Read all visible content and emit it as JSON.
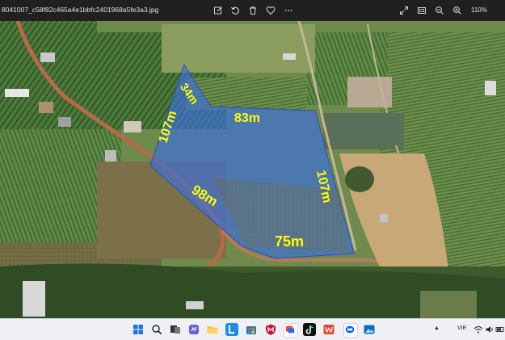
{
  "window": {
    "filename": "8041007_c58f82c465a4e1bbfc2401968a5fe3a3.jpg",
    "zoom": "110%"
  },
  "toolbar_icons": [
    "edit-icon",
    "rotate-icon",
    "delete-icon",
    "favorite-icon",
    "more-icon",
    "expand-icon",
    "fit-icon",
    "zoom-out-icon",
    "zoom-in-icon"
  ],
  "plot": {
    "labels": {
      "top_left": "34m",
      "top": "83m",
      "left": "107m",
      "right": "107m",
      "diagonal": "98m",
      "bottom": "75m"
    },
    "label_color": "#ffff00",
    "overlay_color": "#3b6ee0"
  },
  "taskbar": {
    "apps": [
      "start-icon",
      "search-icon",
      "task-view-icon",
      "widgets-icon",
      "chat-icon",
      "file-explorer-icon",
      "app-l-icon",
      "store-icon",
      "mcafee-icon",
      "zalo-icon",
      "tiktok-icon",
      "wps-icon",
      "zalo-app-icon",
      "photos-icon"
    ],
    "tray": {
      "lang": "VIE"
    }
  }
}
